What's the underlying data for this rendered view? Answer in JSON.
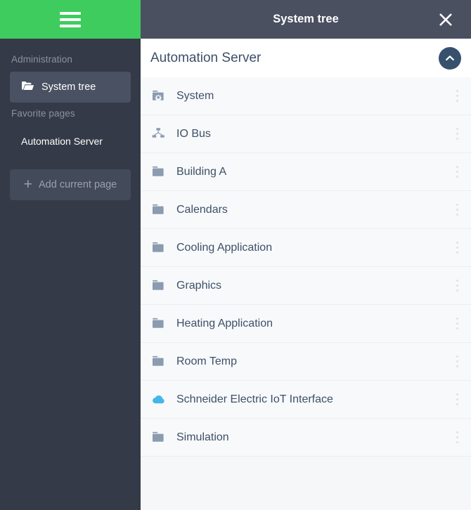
{
  "sidebar": {
    "menu_icon": "hamburger-icon",
    "accent_color": "#3ecc5f",
    "background_color": "#343a47",
    "administration_label": "Administration",
    "system_tree": {
      "label": "System tree",
      "icon": "open-folder-icon"
    },
    "favorite_pages_label": "Favorite pages",
    "favorites": [
      {
        "label": "Automation Server"
      }
    ],
    "add_current_page": {
      "label": "Add current page",
      "icon": "plus-icon"
    }
  },
  "titlebar": {
    "title": "System tree",
    "close_icon": "close-icon",
    "background_color": "#4a5060"
  },
  "panel_header": {
    "root_title": "Automation Server",
    "collapse_icon": "chevron-up-icon",
    "collapse_button_color": "#37506c"
  },
  "tree": {
    "kebab_icon": "more-vertical-icon",
    "items": [
      {
        "label": "System",
        "icon": "folder-gear-icon",
        "icon_color": "#8b9bb0"
      },
      {
        "label": "IO Bus",
        "icon": "hierarchy-icon",
        "icon_color": "#8b9bb0"
      },
      {
        "label": "Building A",
        "icon": "folder-icon",
        "icon_color": "#8b9bb0"
      },
      {
        "label": "Calendars",
        "icon": "folder-icon",
        "icon_color": "#8b9bb0"
      },
      {
        "label": "Cooling Application",
        "icon": "folder-icon",
        "icon_color": "#8b9bb0"
      },
      {
        "label": "Graphics",
        "icon": "folder-icon",
        "icon_color": "#8b9bb0"
      },
      {
        "label": "Heating Application",
        "icon": "folder-icon",
        "icon_color": "#8b9bb0"
      },
      {
        "label": "Room Temp",
        "icon": "folder-icon",
        "icon_color": "#8b9bb0"
      },
      {
        "label": "Schneider Electric IoT Interface",
        "icon": "cloud-icon",
        "icon_color": "#43b7e8"
      },
      {
        "label": "Simulation",
        "icon": "folder-icon",
        "icon_color": "#8b9bb0"
      }
    ]
  }
}
